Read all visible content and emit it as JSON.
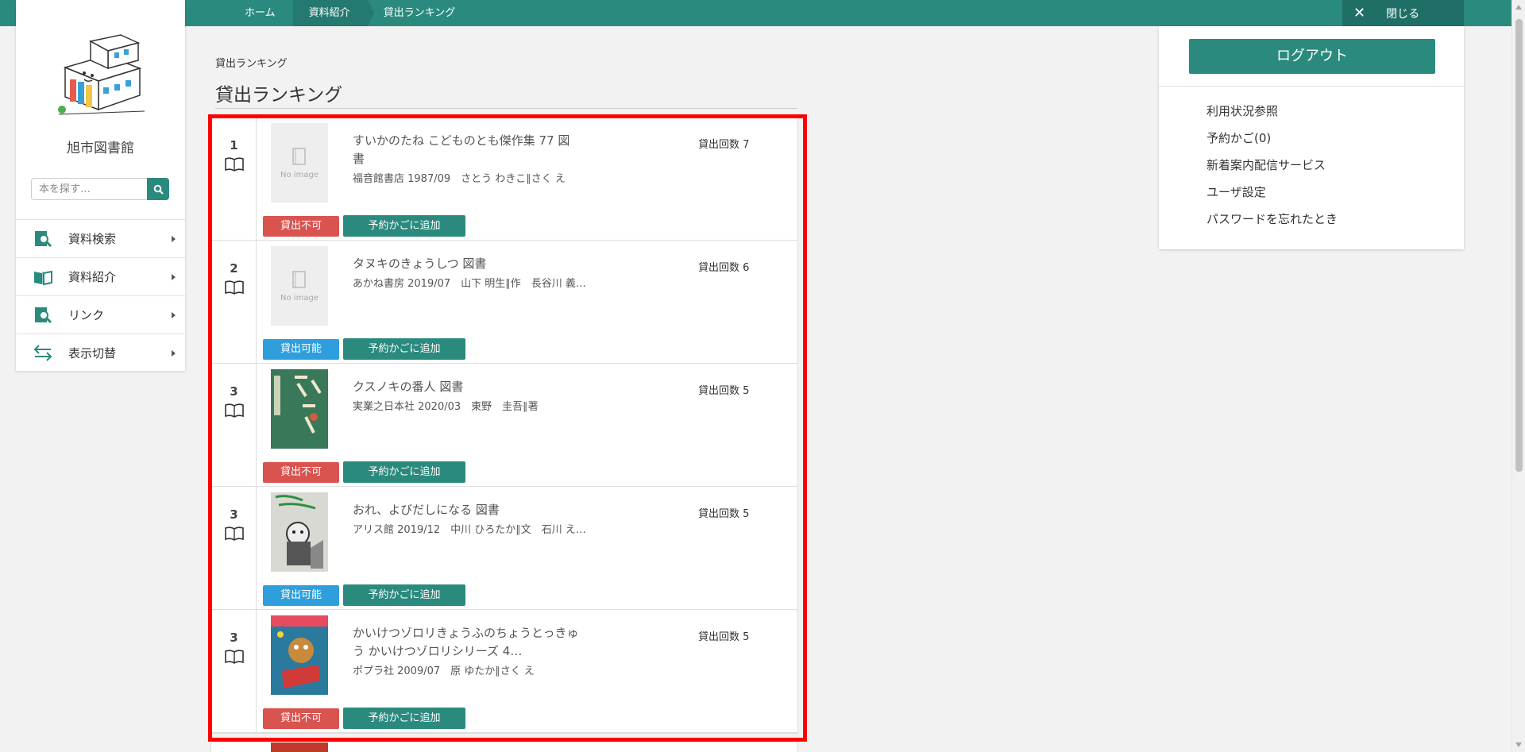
{
  "breadcrumb": [
    "ホーム",
    "資料紹介",
    "貸出ランキング"
  ],
  "close_label": "閉じる",
  "sidebar": {
    "library_name": "旭市図書館",
    "search_placeholder": "本を探す…",
    "menu": [
      {
        "label": "資料検索",
        "icon": "search-doc-icon"
      },
      {
        "label": "資料紹介",
        "icon": "open-book-icon"
      },
      {
        "label": "リンク",
        "icon": "link-search-icon"
      },
      {
        "label": "表示切替",
        "icon": "switch-arrows-icon"
      }
    ]
  },
  "main": {
    "small_title": "貸出ランキング",
    "page_title": "貸出ランキング",
    "no_image_text": "No image",
    "items": [
      {
        "rank": "1",
        "title_lines": [
          "すいかのたね こどものとも傑作集 77 図",
          "書"
        ],
        "meta": "福音館書店 1987/09　さとう わきこ∥さく え",
        "count": "貸出回数 7",
        "status": "貸出不可",
        "add_label": "予約かごに追加"
      },
      {
        "rank": "2",
        "title_lines": [
          "タヌキのきょうしつ 図書"
        ],
        "meta": "あかね書房 2019/07　山下 明生∥作　長谷川 義…",
        "count": "貸出回数 6",
        "status": "貸出可能",
        "add_label": "予約かごに追加"
      },
      {
        "rank": "3",
        "title_lines": [
          "クスノキの番人 図書"
        ],
        "meta": "実業之日本社 2020/03　東野　圭吾∥著",
        "count": "貸出回数 5",
        "status": "貸出不可",
        "add_label": "予約かごに追加"
      },
      {
        "rank": "3",
        "title_lines": [
          "おれ、よびだしになる 図書"
        ],
        "meta": "アリス館 2019/12　中川 ひろたか∥文　石川 え…",
        "count": "貸出回数 5",
        "status": "貸出可能",
        "add_label": "予約かごに追加"
      },
      {
        "rank": "3",
        "title_lines": [
          "かいけつゾロリきょうふのちょうとっきゅ",
          "う かいけつゾロリシリーズ 4…"
        ],
        "meta": "ポプラ社 2009/07　原 ゆたか∥さく え",
        "count": "貸出回数 5",
        "status": "貸出不可",
        "add_label": "予約かごに追加"
      }
    ]
  },
  "right_panel": {
    "logout_label": "ログアウト",
    "links": [
      "利用状況参照",
      "予約かご(0)",
      "新着案内配信サービス",
      "ユーザ設定",
      "パスワードを忘れたとき"
    ]
  },
  "colors": {
    "accent": "#2b8a7e",
    "unavailable": "#d9534f",
    "available": "#2e9fdc",
    "highlight": "#ff0000"
  }
}
